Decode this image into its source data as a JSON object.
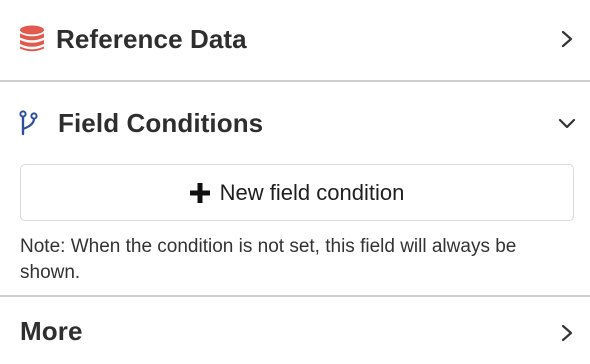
{
  "sections": {
    "reference_data": {
      "title": "Reference Data",
      "icon": "database-icon",
      "icon_color": "#e05a4e",
      "state": "collapsed"
    },
    "field_conditions": {
      "title": "Field Conditions",
      "icon": "branch-icon",
      "icon_color": "#2f4e9a",
      "state": "expanded",
      "new_button_label": "New field condition",
      "note": "Note: When the condition is not set, this field will always be shown."
    },
    "more": {
      "title": "More",
      "state": "collapsed"
    }
  }
}
